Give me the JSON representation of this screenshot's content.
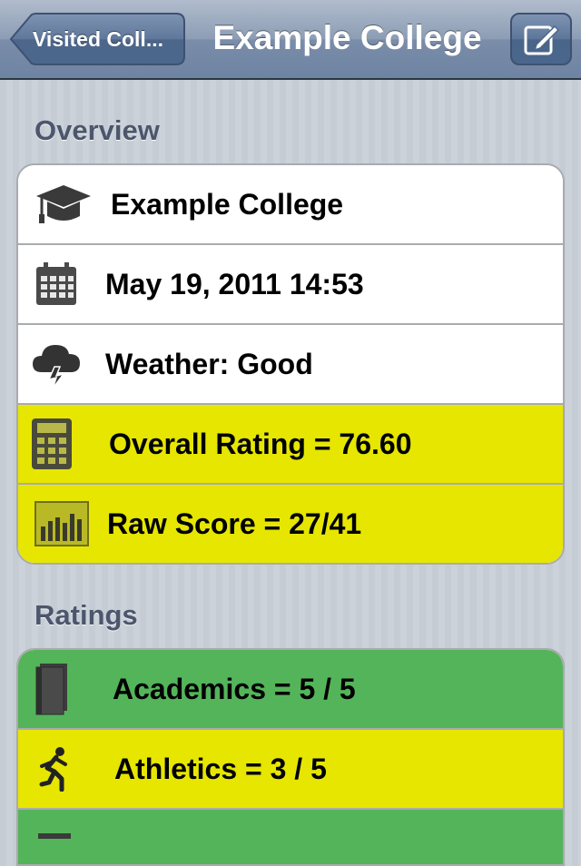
{
  "navbar": {
    "back_label": "Visited Coll...",
    "title": "Example College",
    "edit_icon": "compose-icon"
  },
  "overview": {
    "header": "Overview",
    "rows": [
      {
        "icon": "graduation-cap-icon",
        "label": "Example College",
        "color": "#ffffff"
      },
      {
        "icon": "calendar-icon",
        "label": "May 19, 2011 14:53",
        "color": "#ffffff"
      },
      {
        "icon": "storm-cloud-icon",
        "label": "Weather: Good",
        "color": "#ffffff"
      },
      {
        "icon": "calculator-icon",
        "label": "Overall Rating = 76.60",
        "color": "#e6e600"
      },
      {
        "icon": "bar-chart-icon",
        "label": "Raw Score = 27/41",
        "color": "#e6e600"
      }
    ]
  },
  "ratings": {
    "header": "Ratings",
    "rows": [
      {
        "icon": "book-icon",
        "label": "Academics = 5 / 5",
        "color": "#54b45a"
      },
      {
        "icon": "runner-icon",
        "label": "Athletics = 3 / 5",
        "color": "#e6e600"
      },
      {
        "icon": "unknown-icon",
        "label": "",
        "color": "#54b45a"
      }
    ]
  }
}
